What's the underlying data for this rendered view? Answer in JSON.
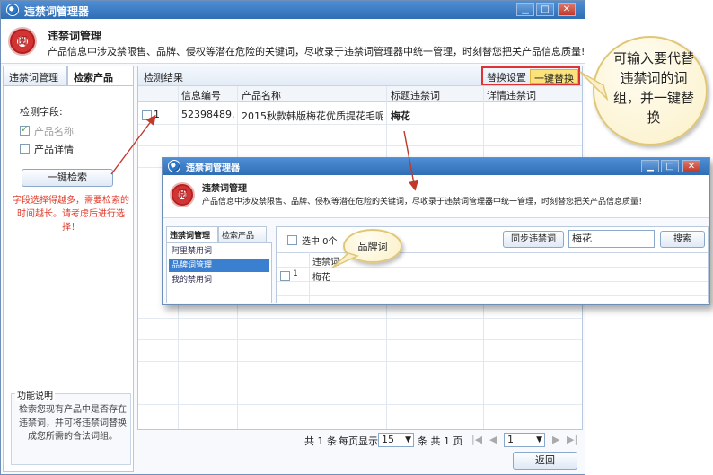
{
  "main": {
    "window_title": "违禁词管理器",
    "header_title": "违禁词管理",
    "header_desc": "产品信息中涉及禁限售、品牌、侵权等潜在危险的关键词，尽收录于违禁词管理器中统一管理，时刻替您把关产品信息质量!",
    "tabs": [
      {
        "label": "违禁词管理"
      },
      {
        "label": "检索产品"
      }
    ],
    "detect_fields_label": "检测字段:",
    "fields": [
      {
        "label": "产品名称",
        "checked": true,
        "disabled": true
      },
      {
        "label": "产品详情",
        "checked": false,
        "disabled": false
      }
    ],
    "search_button": "一键检索",
    "warning": "字段选择得越多，需要检索的时间越长。请考虑后进行选择！",
    "func_title": "功能说明",
    "func_text": "检索您现有产品中是否存在违禁词，并可将违禁词替换成您所需的合法词组。",
    "results_title": "检测结果",
    "replace_settings": "替换设置",
    "one_click_replace": "一键替换",
    "columns": [
      "信息编号",
      "产品名称",
      "标题违禁词",
      "详情违禁词"
    ],
    "rows": [
      {
        "num": "1",
        "id": "52398489...",
        "name": "2015秋款韩版梅花优质提花毛呢...",
        "title_word": "梅花",
        "detail_word": ""
      }
    ],
    "pager": {
      "total_prefix": "共 1 条",
      "per_page_label": "每页显示",
      "per_page": "15",
      "pages_label": "条 共 1 页",
      "current_page": "1",
      "back": "返回"
    }
  },
  "overlay": {
    "window_title": "违禁词管理器",
    "header_title": "违禁词管理",
    "header_desc": "产品信息中涉及禁限售、品牌、侵权等潜在危险的关键词，尽收录于违禁词管理器中统一管理，时刻替您把关产品信息质量！",
    "tabs": [
      {
        "label": "违禁词管理"
      },
      {
        "label": "检索产品"
      }
    ],
    "list": [
      "阿里禁用词",
      "品牌词管理",
      "我的禁用词"
    ],
    "selected_count": "选中 0个",
    "sync_button": "同步违禁词",
    "search_value": "梅花",
    "search_button": "搜索",
    "column": "违禁词",
    "rows": [
      {
        "num": "1",
        "word": "梅花"
      }
    ]
  },
  "callouts": {
    "right": "可输入要代替违禁词的词组，并一键替换",
    "brand": "品牌词"
  }
}
